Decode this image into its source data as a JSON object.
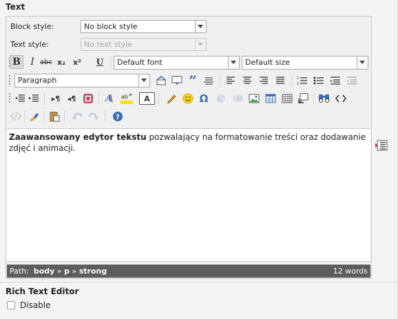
{
  "section_title": "Text",
  "block_style": {
    "label": "Block style:",
    "value": "No block style"
  },
  "text_style": {
    "label": "Text style:",
    "value": "No text style"
  },
  "font": {
    "value": "Default font"
  },
  "size": {
    "value": "Default size"
  },
  "format": {
    "value": "Paragraph"
  },
  "toolbar": {
    "bold": "B",
    "italic": "I",
    "strike": "abc",
    "subscript": "x₂",
    "superscript": "x²",
    "underline": "U",
    "ltr": "▸¶",
    "rtl": "◂¶",
    "omega": "Ω",
    "text_color": "A",
    "source_label": "<>"
  },
  "content": {
    "bold_text": "Zaawansowany edytor tekstu",
    "normal_text": " pozwalający na formatowanie treści oraz dodawanie zdjęć i animacji."
  },
  "statusbar": {
    "path_label": "Path:",
    "path": [
      "body",
      "p",
      "strong"
    ],
    "separator": "»",
    "word_count": "12 words"
  },
  "rte": {
    "title": "Rich Text Editor",
    "disable_label": "Disable"
  },
  "colors": {
    "statusbar_bg": "#5d5d5d",
    "accent_blue": "#3a6fb5"
  }
}
